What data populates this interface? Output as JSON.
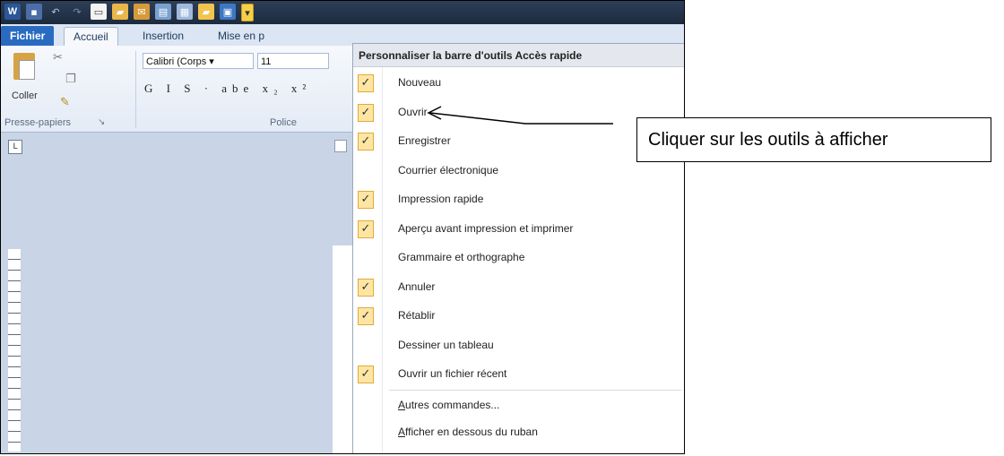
{
  "ribbon": {
    "tabs": [
      "Fichier",
      "Accueil",
      "Insertion",
      "Mise en p"
    ],
    "paste_label": "Coller",
    "font_name": "Calibri (Corps ▾",
    "font_size": "11",
    "format_buttons": "G I S · abe x₂ x²",
    "group_clipboard": "Presse-papiers",
    "group_font": "Police"
  },
  "menu": {
    "title": "Personnaliser la barre d'outils Accès rapide",
    "check_glyph": "✓",
    "items": [
      {
        "label": "Nouveau",
        "checked": true
      },
      {
        "label": "Ouvrir",
        "checked": true
      },
      {
        "label": "Enregistrer",
        "checked": true
      },
      {
        "label": "Courrier électronique",
        "checked": false
      },
      {
        "label": "Impression rapide",
        "checked": true
      },
      {
        "label": "Aperçu avant impression et imprimer",
        "checked": true
      },
      {
        "label": "Grammaire et orthographe",
        "checked": false
      },
      {
        "label": "Annuler",
        "checked": true
      },
      {
        "label": "Rétablir",
        "checked": true
      },
      {
        "label": "Dessiner un tableau",
        "checked": false
      },
      {
        "label": "Ouvrir un fichier récent",
        "checked": true
      }
    ],
    "more_commands": {
      "underlined": "A",
      "rest": "utres commandes..."
    },
    "show_below": {
      "underlined": "A",
      "rest": "fficher en dessous du ruban"
    }
  },
  "callout": {
    "text": "Cliquer sur les outils à afficher"
  },
  "colors": {
    "check_fill": "#fde6a3",
    "check_border": "#e3a93a",
    "file_tab": "#2a6bc1"
  }
}
